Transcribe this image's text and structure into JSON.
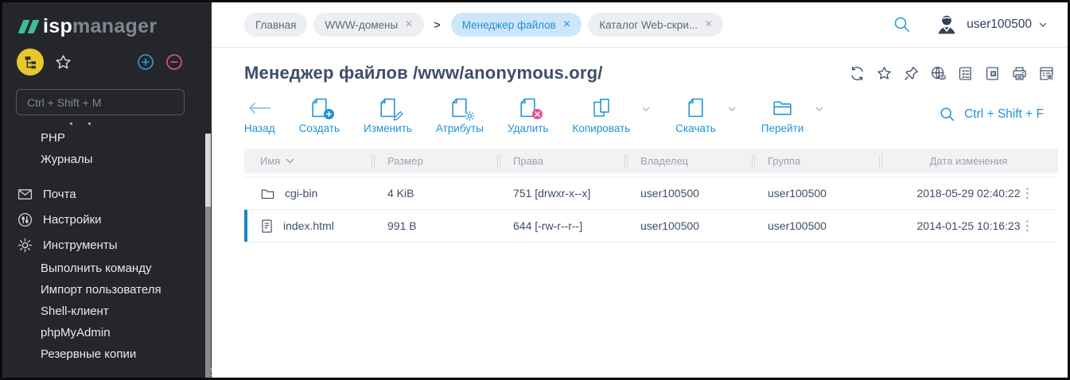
{
  "colors": {
    "accent": "#2192d6",
    "teal": "#3dbd98",
    "yellow": "#e9c62b",
    "pink": "#e8509a",
    "pink_badge": "#ea4f93",
    "sidebar_bg": "#24262b",
    "tab_bg": "#edeff2",
    "active_tab_bg": "#cde6fa"
  },
  "sidebar": {
    "logo_isp": "isp",
    "logo_manager": "manager",
    "search_placeholder": "Ctrl + Shift + M",
    "menu": [
      {
        "label": "PHP"
      },
      {
        "label": "Журналы"
      },
      {
        "label": "Почта",
        "icon": "mail-icon"
      },
      {
        "label": "Настройки",
        "icon": "sliders-icon"
      },
      {
        "label": "Инструменты",
        "icon": "gear-icon"
      },
      {
        "label": "Выполнить команду"
      },
      {
        "label": "Импорт пользователя"
      },
      {
        "label": "Shell-клиент"
      },
      {
        "label": "phpMyAdmin"
      },
      {
        "label": "Резервные копии"
      }
    ]
  },
  "topbar": {
    "tabs": [
      {
        "label": "Главная"
      },
      {
        "label": "WWW-домены"
      },
      {
        "label": "Менеджер файлов"
      },
      {
        "label": "Каталог Web-скри..."
      }
    ],
    "separator": ">",
    "close_glyph": "×",
    "username": "user100500"
  },
  "page": {
    "title": "Менеджер файлов /www/anonymous.org/",
    "action_icons": [
      "refresh-icon",
      "favorite-star-icon",
      "pin-icon",
      "web-icon",
      "log-list-icon",
      "export-excel-icon",
      "print-icon",
      "table-settings-icon"
    ]
  },
  "toolbar": {
    "back": "Назад",
    "create": "Создать",
    "edit": "Изменить",
    "attrs": "Атрибуты",
    "delete": "Удалить",
    "copy": "Копировать",
    "download": "Скачать",
    "goto": "Перейти",
    "search_shortcut": "Ctrl + Shift + F"
  },
  "table": {
    "columns": [
      "Имя",
      "Размер",
      "Права",
      "Владелец",
      "Группа",
      "Дата изменения"
    ],
    "rows": [
      {
        "name": "cgi-bin",
        "type": "folder",
        "size": "4 KiB",
        "perms": "751 [drwxr-x--x]",
        "owner": "user100500",
        "group": "user100500",
        "modified": "2018-05-29 02:40:22"
      },
      {
        "name": "index.html",
        "type": "file",
        "size": "991 B",
        "perms": "644 [-rw-r--r--]",
        "owner": "user100500",
        "group": "user100500",
        "modified": "2014-01-25 10:16:23",
        "selected": true
      }
    ],
    "kebab_glyph": "⋮"
  }
}
